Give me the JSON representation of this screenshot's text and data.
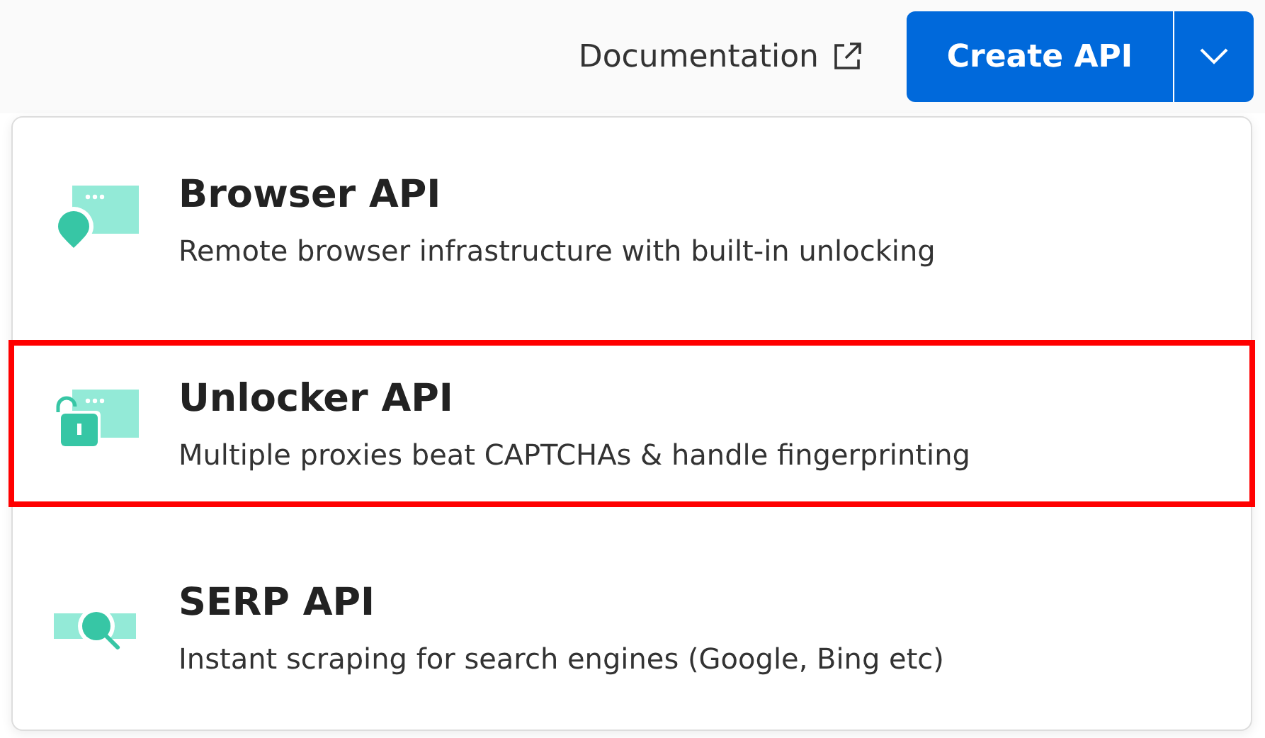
{
  "header": {
    "documentation_link": "Documentation",
    "create_button": "Create API"
  },
  "menu": {
    "items": [
      {
        "kind": "browser",
        "title": "Browser API",
        "description": "Remote browser infrastructure with built-in unlocking",
        "selected": false
      },
      {
        "kind": "unlocker",
        "title": "Unlocker API",
        "description": "Multiple proxies beat CAPTCHAs & handle fingerprinting",
        "selected": true
      },
      {
        "kind": "serp",
        "title": "SERP API",
        "description": "Instant scraping for search engines (Google, Bing etc)",
        "selected": false
      }
    ]
  }
}
